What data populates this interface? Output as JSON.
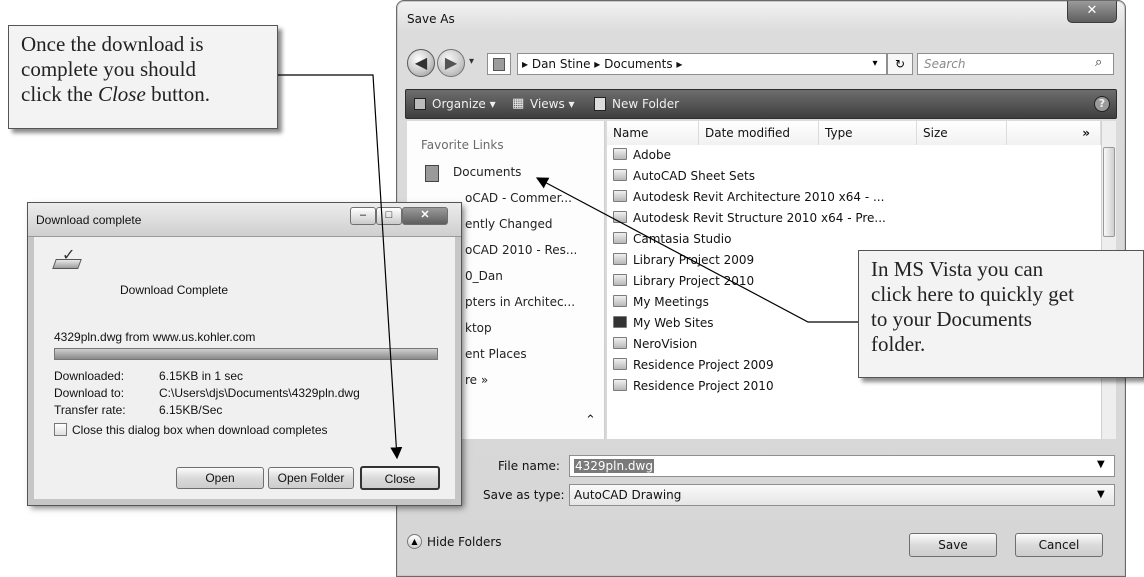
{
  "callout_top_left": {
    "line1": "Once the download is",
    "line2": "complete you should",
    "line3_pre": "click the ",
    "line3_italic": "Close",
    "line3_post": " button."
  },
  "callout_right": {
    "line1": "In MS Vista you can",
    "line2": "click here to quickly get",
    "line3": "to your Documents",
    "line4": "folder."
  },
  "save_as": {
    "title": "Save As",
    "address": "▸ Dan Stine ▸ Documents ▸",
    "search_placeholder": "Search",
    "toolbar": {
      "organize": "Organize ▾",
      "views": "Views ▾",
      "new_folder": "New Folder"
    },
    "left_pane": {
      "header": "Favorite Links",
      "items": [
        "Documents",
        "oCAD - Commer...",
        "ently Changed",
        "oCAD 2010 - Res...",
        "0_Dan",
        "pters in Architec...",
        "ktop",
        "ent Places",
        "re »"
      ]
    },
    "columns": [
      "Name",
      "Date modified",
      "Type",
      "Size",
      "»"
    ],
    "files": [
      "Adobe",
      "AutoCAD Sheet Sets",
      "Autodesk Revit Architecture 2010 x64 - ...",
      "Autodesk Revit Structure 2010 x64 - Pre...",
      "Camtasia Studio",
      "Library Project 2009",
      "Library Project 2010",
      "My Meetings",
      "My Web Sites",
      "NeroVision",
      "Residence Project 2009",
      "Residence Project 2010"
    ],
    "file_name_label": "File name:",
    "file_name_value": "4329pln.dwg",
    "save_type_label": "Save as type:",
    "save_type_value": "AutoCAD Drawing",
    "hide_folders": "Hide Folders",
    "save_button": "Save",
    "cancel_button": "Cancel"
  },
  "download": {
    "title": "Download complete",
    "heading": "Download Complete",
    "source": "4329pln.dwg from www.us.kohler.com",
    "progress": 1.0,
    "downloaded_label": "Downloaded:",
    "downloaded_value": "6.15KB in 1 sec",
    "download_to_label": "Download to:",
    "download_to_value": "C:\\Users\\djs\\Documents\\4329pln.dwg",
    "transfer_label": "Transfer rate:",
    "transfer_value": "6.15KB/Sec",
    "checkbox_label": "Close this dialog box when download completes",
    "open_button": "Open",
    "open_folder_button": "Open Folder",
    "close_button": "Close"
  }
}
